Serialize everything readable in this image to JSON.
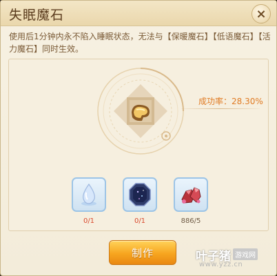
{
  "dialog": {
    "title": "失眠魔石",
    "close_symbol": "×",
    "description": "使用后1分钟内永不陷入睡眠状态，无法与【保暖魔石】【低语魔石】【活力魔石】同时生效。"
  },
  "success_rate": {
    "label": "成功率：28.30%",
    "value_percent": 28.3
  },
  "product": {
    "icon": "sleepless-stone-icon"
  },
  "materials": [
    {
      "icon": "water-drop-icon",
      "count": "0/1"
    },
    {
      "icon": "dark-octagon-gem-icon",
      "count": "0/1"
    },
    {
      "icon": "red-crystal-ore-icon",
      "count": "886/5"
    }
  ],
  "actions": {
    "craft_label": "制作"
  },
  "watermark": {
    "main": "叶子猪",
    "tag": "游戏网",
    "url": "www.yzz.cn"
  },
  "colors": {
    "rate_text": "#e07b24",
    "count_insufficient": "#d9472b",
    "button_orange": "#f7a51f"
  }
}
